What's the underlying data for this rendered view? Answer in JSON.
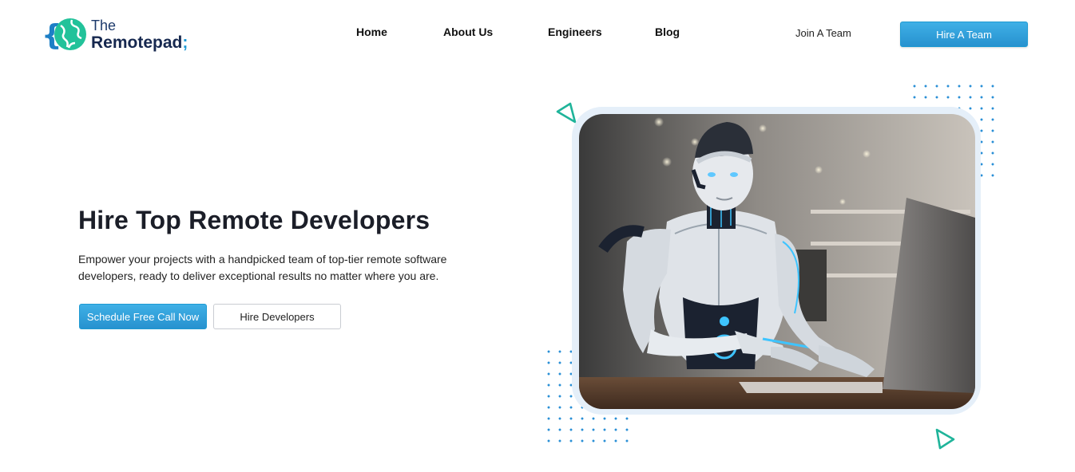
{
  "header": {
    "logo": {
      "line1": "The",
      "line2": "Remotepad",
      "semicolon": ";"
    },
    "nav": [
      {
        "label": "Home"
      },
      {
        "label": "About Us"
      },
      {
        "label": "Engineers"
      },
      {
        "label": "Blog"
      }
    ],
    "join_label": "Join A Team",
    "hire_team_label": "Hire A Team"
  },
  "hero": {
    "title": "Hire Top Remote Developers",
    "subtitle": "Empower your projects with a handpicked team of top-tier remote software developers, ready to deliver exceptional results no matter where you are.",
    "primary_cta": "Schedule Free Call Now",
    "secondary_cta": "Hire Developers",
    "image_icon": "robot-at-laptop-photo"
  },
  "colors": {
    "accent_blue": "#2a9ad8",
    "teal": "#1fb49a",
    "navy": "#16284f"
  }
}
